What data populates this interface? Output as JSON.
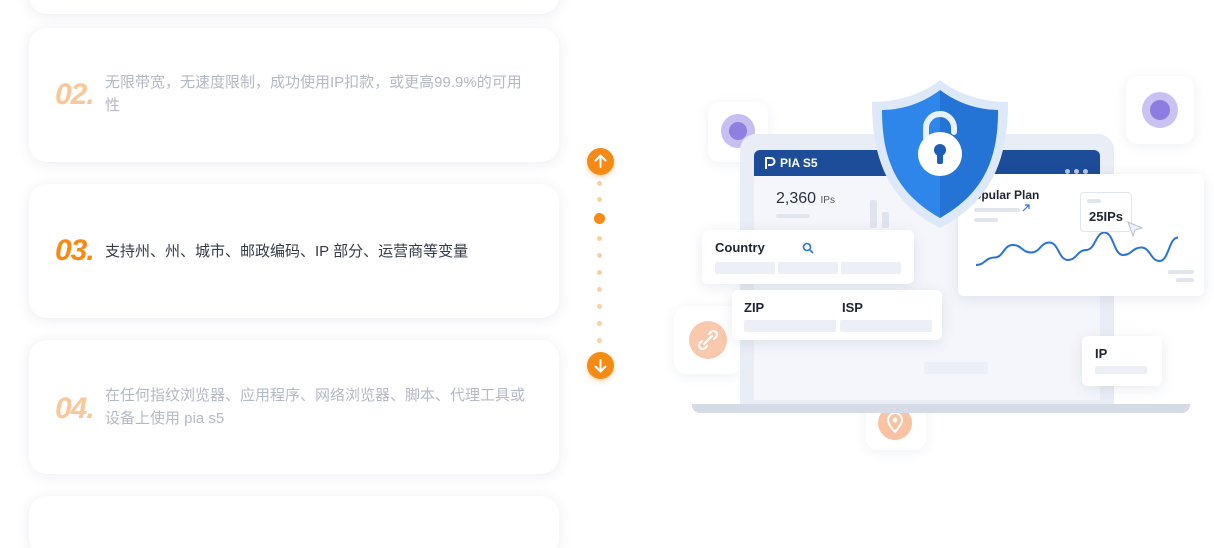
{
  "features": [
    {
      "num": "02.",
      "text": "无限带宽，无速度限制，成功使用IP扣款，或更高99.9%的可用性"
    },
    {
      "num": "03.",
      "text": "支持州、州、城市、邮政编码、IP 部分、运营商等变量"
    },
    {
      "num": "04.",
      "text": "在任何指纹浏览器、应用程序、网络浏览器、脚本、代理工具或设备上使用 pia s5"
    }
  ],
  "stepper": {
    "up_icon": "arrow-up-icon",
    "down_icon": "arrow-down-icon",
    "accent": "#f58a14"
  },
  "illustration": {
    "brand": "PIA S5",
    "ips_count": "2,360",
    "ips_unit": "IPs",
    "popular_plan": "opular Plan",
    "plan_value": "25IPs",
    "country_label": "Country",
    "zip_label": "ZIP",
    "isp_label": "ISP",
    "ip_label": "IP",
    "line_series": [
      0.7,
      0.55,
      0.3,
      0.45,
      0.25,
      0.6,
      0.4,
      0.05,
      0.5,
      0.35,
      0.62,
      0.15
    ]
  },
  "colors": {
    "shield": "#2f86ea",
    "topbar": "#1d4d99",
    "chart_line": "#2a73d6"
  }
}
